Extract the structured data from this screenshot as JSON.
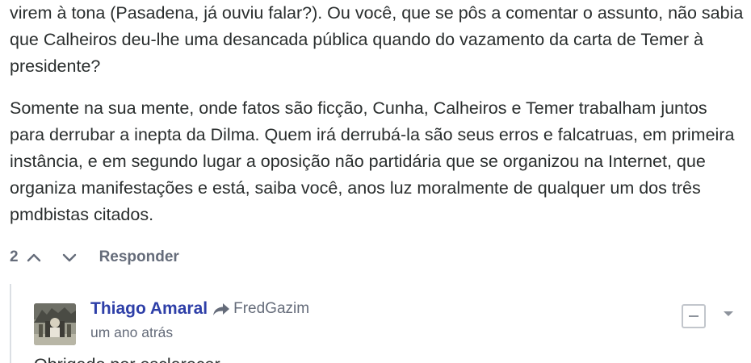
{
  "comment": {
    "paragraphs": [
      "virem à tona (Pasadena, já ouviu falar?). Ou você, que se pôs a comentar o assunto, não sabia que Calheiros deu-lhe uma desancada pública quando do vazamento da carta de Temer à presidente?",
      "Somente na sua mente, onde fatos são ficção, Cunha, Calheiros e Temer trabalham juntos para derrubar a inepta da Dilma. Quem irá derrubá-la são seus erros e falcatruas, em primeira instância, e em segundo lugar a oposição não partidária que se organizou na Internet, que organiza manifestações e está, saiba você, anos luz moralmente de qualquer um dos três pmdbistas citados."
    ],
    "vote_count": "2",
    "upvote_icon": "chevron-up-icon",
    "downvote_icon": "chevron-down-icon",
    "reply_label": "Responder"
  },
  "reply": {
    "author": "Thiago Amaral",
    "reply_icon": "share-arrow-icon",
    "in_reply_to": "FredGazim",
    "timestamp": "um ano atrás",
    "text": "Obrigado por esclarecer."
  },
  "colors": {
    "author": "#2e3fa8",
    "meta": "#656c7a",
    "body_text": "#2a2e2e",
    "thread_line": "#dbdfe4"
  }
}
